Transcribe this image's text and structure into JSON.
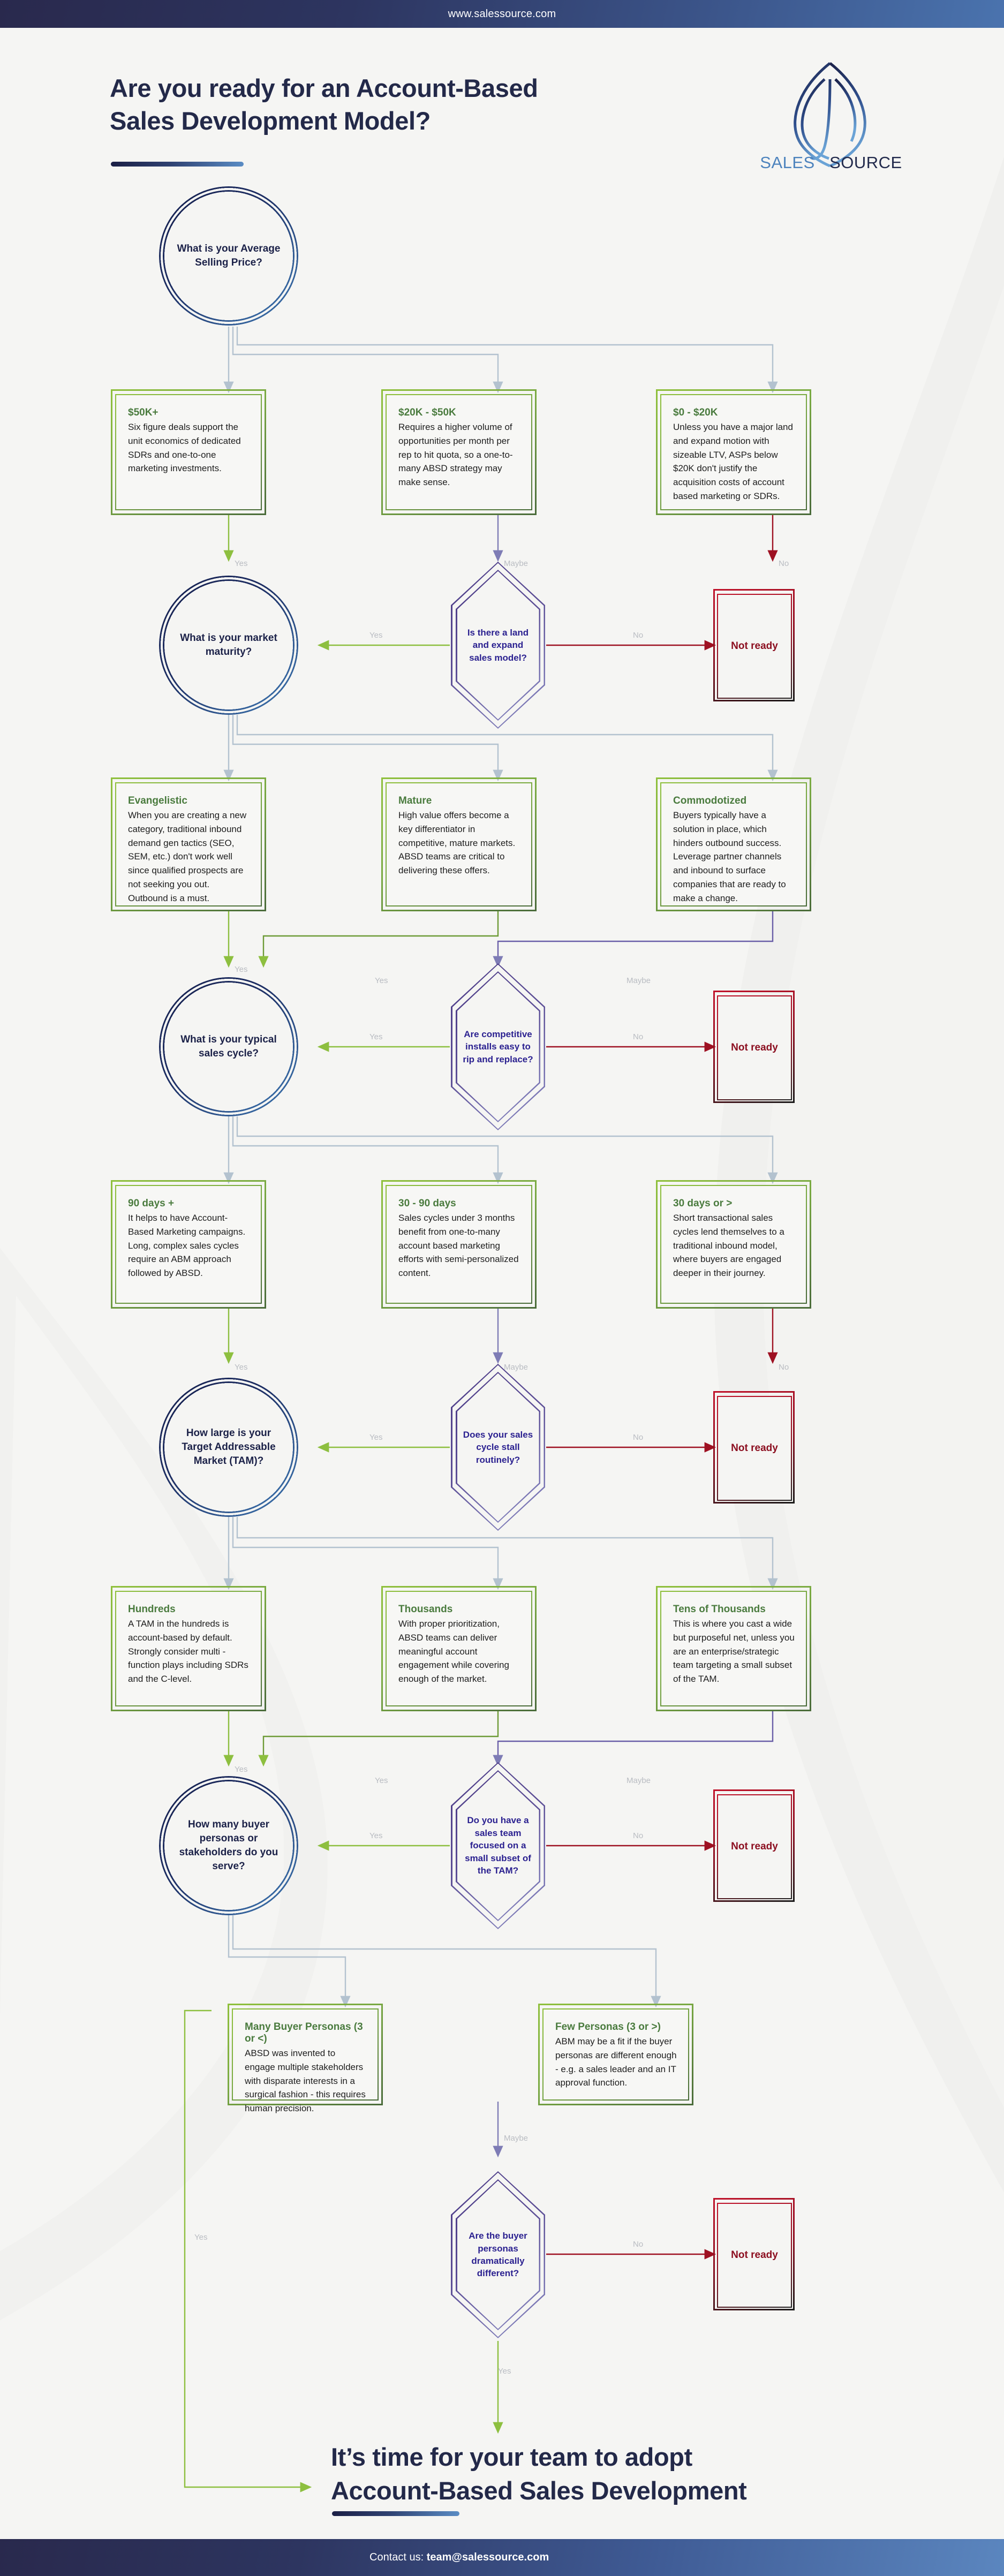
{
  "topbar": {
    "url": "www.salessource.com"
  },
  "footer": {
    "prefix": "Contact us: ",
    "email": "team@salessource.com"
  },
  "header": {
    "title_line1": "Are you ready for an Account-Based",
    "title_line2": "Sales Development Model?",
    "logo_word_1": "SALES",
    "logo_word_2": "SOURCE"
  },
  "conclusion": {
    "line1": "It’s time for your team to adopt",
    "line2": "Account-Based Sales Development"
  },
  "colors": {
    "navy": "#232949",
    "accent_blue": "#4d83bd",
    "green": "#8fc03c",
    "green_dark": "#4a7b3e",
    "purple": "#5b4d95",
    "red": "#8c0f20",
    "label_grey": "#b9bcc2",
    "page_bg": "#f5f5f3"
  },
  "labels": {
    "yes": "Yes",
    "no": "No",
    "maybe": "Maybe",
    "not_ready": "Not ready"
  },
  "questions": [
    {
      "id": "q1",
      "text": "What is your Average Selling Price?"
    },
    {
      "id": "q2",
      "text": "What is your market maturity?"
    },
    {
      "id": "q3",
      "text": "What is your typical sales cycle?"
    },
    {
      "id": "q4",
      "text": "How large is your Target Addressable Market (TAM)?"
    },
    {
      "id": "q5",
      "text": "How many buyer personas or stakeholders do you serve?"
    }
  ],
  "decisions": [
    {
      "id": "d1",
      "text": "Is there a land and expand sales model?"
    },
    {
      "id": "d2",
      "text": "Are competitive installs easy to rip and replace?"
    },
    {
      "id": "d3",
      "text": "Does your sales cycle stall routinely?"
    },
    {
      "id": "d4",
      "text": "Do you have a sales team focused on a small subset of the TAM?"
    },
    {
      "id": "d5",
      "text": "Are the buyer personas dramatically different?"
    }
  ],
  "rows": [
    {
      "id": "row1",
      "cards": [
        {
          "head": "$50K+",
          "body": "Six figure deals support the unit economics of dedicated SDRs and one-to-one marketing investments."
        },
        {
          "head": "$20K - $50K",
          "body": "Requires a higher volume of opportunities per month per rep to hit quota, so a one-to-many ABSD strategy may make sense."
        },
        {
          "head": "$0 - $20K",
          "body": "Unless you have a major land and expand motion with sizeable LTV, ASPs below $20K don't justify the acquisition costs of account based marketing or SDRs."
        }
      ]
    },
    {
      "id": "row2",
      "cards": [
        {
          "head": "Evangelistic",
          "body": "When you are creating a new category, traditional inbound demand gen tactics (SEO, SEM, etc.) don't work well since qualified prospects are not seeking you out. Outbound is a must."
        },
        {
          "head": "Mature",
          "body": "High value offers become a key differentiator in competitive, mature markets. ABSD teams are critical to delivering these offers."
        },
        {
          "head": "Commodotized",
          "body": "Buyers typically have a solution in place, which hinders outbound success. Leverage partner channels and inbound to surface companies that are ready to make a change."
        }
      ]
    },
    {
      "id": "row3",
      "cards": [
        {
          "head": "90 days +",
          "body": "It helps to have Account-Based Marketing campaigns. Long, complex sales cycles require an ABM approach followed by ABSD."
        },
        {
          "head": "30 - 90 days",
          "body": "Sales cycles under 3 months benefit from one-to-many account based marketing efforts with semi-personalized content."
        },
        {
          "head": "30 days or >",
          "body": "Short transactional sales cycles lend themselves to a traditional inbound model, where buyers are engaged deeper in their journey."
        }
      ]
    },
    {
      "id": "row4",
      "cards": [
        {
          "head": "Hundreds",
          "body": "A TAM in the hundreds is account-based by default. Strongly consider multi - function plays including SDRs and the C-level."
        },
        {
          "head": "Thousands",
          "body": "With proper prioritization, ABSD teams can deliver meaningful account engagement while covering enough of the market."
        },
        {
          "head": "Tens of Thousands",
          "body": "This is where you cast a wide but purposeful net, unless you are an enterprise/strategic team targeting a small subset of the TAM."
        }
      ]
    },
    {
      "id": "row5",
      "cards": [
        {
          "head": "Many Buyer Personas (3 or <)",
          "body": "ABSD was invented to engage multiple stakeholders with disparate interests in a surgical fashion - this requires human precision."
        },
        {
          "head": "Few Personas (3 or >)",
          "body": "ABM may be a fit if the buyer personas are different enough - e.g. a sales leader and an IT approval function."
        }
      ]
    }
  ]
}
